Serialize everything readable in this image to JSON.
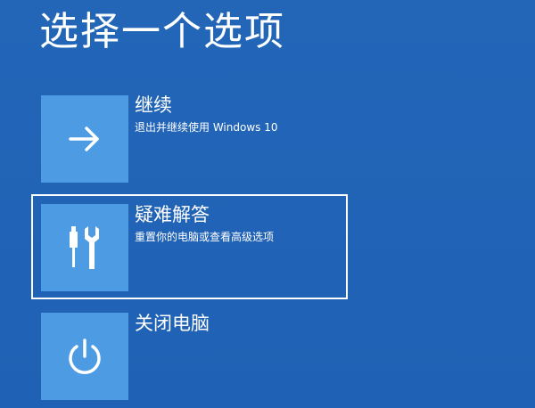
{
  "page": {
    "title": "选择一个选项"
  },
  "options": [
    {
      "label": "继续",
      "description": "退出并继续使用 Windows 10",
      "icon": "arrow-right-icon"
    },
    {
      "label": "疑难解答",
      "description": "重置你的电脑或查看高级选项",
      "icon": "tools-icon",
      "selected": true
    },
    {
      "label": "关闭电脑",
      "icon": "power-icon"
    }
  ],
  "colors": {
    "background": "#1f62b5",
    "tile": "#4d9be3",
    "text": "#ffffff",
    "selection_border": "#ffffff"
  }
}
